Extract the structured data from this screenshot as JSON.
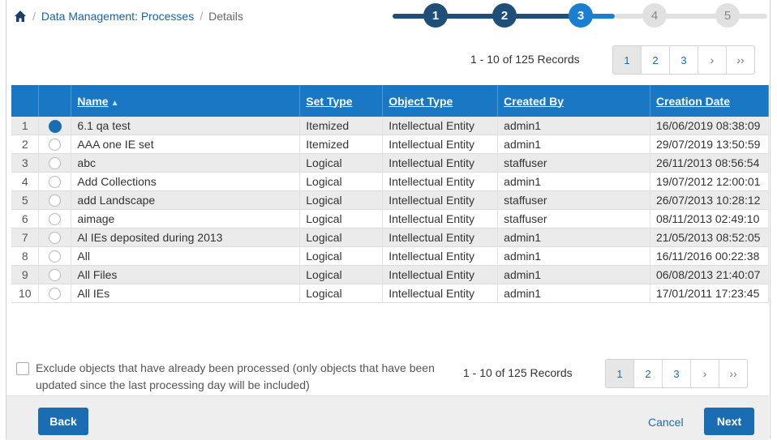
{
  "breadcrumb": {
    "items": [
      "Data Management: Processes",
      "Details"
    ]
  },
  "stepper": {
    "steps": [
      "1",
      "2",
      "3",
      "4",
      "5"
    ],
    "current": 3,
    "colors": {
      "done": "#1f4e79",
      "current": "#1a7fd0",
      "pending": "#e1e1e1"
    }
  },
  "pagination_top": {
    "records_text": "1 - 10 of 125 Records",
    "pages": [
      "1",
      "2",
      "3"
    ],
    "active_page": "1",
    "next": "›",
    "last": "››"
  },
  "table": {
    "columns": [
      "Name",
      "Set Type",
      "Object Type",
      "Created By",
      "Creation Date"
    ],
    "rows": [
      {
        "num": "1",
        "name": "6.1 qa test",
        "set_type": "Itemized",
        "object_type": "Intellectual Entity",
        "created_by": "admin1",
        "creation_date": "16/06/2019 08:38:09",
        "selected": true
      },
      {
        "num": "2",
        "name": "AAA one IE set",
        "set_type": "Itemized",
        "object_type": "Intellectual Entity",
        "created_by": "admin1",
        "creation_date": "29/07/2019 13:50:59",
        "selected": false
      },
      {
        "num": "3",
        "name": "abc",
        "set_type": "Logical",
        "object_type": "Intellectual Entity",
        "created_by": "staffuser",
        "creation_date": "26/11/2013 08:56:54",
        "selected": false
      },
      {
        "num": "4",
        "name": "Add Collections",
        "set_type": "Logical",
        "object_type": "Intellectual Entity",
        "created_by": "admin1",
        "creation_date": "19/07/2012 12:00:01",
        "selected": false
      },
      {
        "num": "5",
        "name": "add Landscape",
        "set_type": "Logical",
        "object_type": "Intellectual Entity",
        "created_by": "staffuser",
        "creation_date": "26/07/2013 10:28:12",
        "selected": false
      },
      {
        "num": "6",
        "name": "aimage",
        "set_type": "Logical",
        "object_type": "Intellectual Entity",
        "created_by": "staffuser",
        "creation_date": "08/11/2013 02:49:10",
        "selected": false
      },
      {
        "num": "7",
        "name": "Al IEs deposited during 2013",
        "set_type": "Logical",
        "object_type": "Intellectual Entity",
        "created_by": "admin1",
        "creation_date": "21/05/2013 08:52:05",
        "selected": false
      },
      {
        "num": "8",
        "name": "All",
        "set_type": "Logical",
        "object_type": "Intellectual Entity",
        "created_by": "admin1",
        "creation_date": "16/11/2016 00:22:38",
        "selected": false
      },
      {
        "num": "9",
        "name": "All Files",
        "set_type": "Logical",
        "object_type": "Intellectual Entity",
        "created_by": "admin1",
        "creation_date": "06/08/2013 21:40:07",
        "selected": false
      },
      {
        "num": "10",
        "name": "All IEs",
        "set_type": "Logical",
        "object_type": "Intellectual Entity",
        "created_by": "admin1",
        "creation_date": "17/01/2011 17:23:45",
        "selected": false
      }
    ]
  },
  "exclude": {
    "label": "Exclude objects that have already been processed (only objects that have been updated since the last processing day will be included)",
    "checked": false
  },
  "pagination_bottom": {
    "records_text": "1 - 10 of 125 Records",
    "pages": [
      "1",
      "2",
      "3"
    ],
    "active_page": "1",
    "next": "›",
    "last": "››"
  },
  "footer": {
    "back_label": "Back",
    "cancel_label": "Cancel",
    "next_label": "Next"
  },
  "icons": {
    "home": "home-icon",
    "sort": "sort-ascending-icon"
  }
}
